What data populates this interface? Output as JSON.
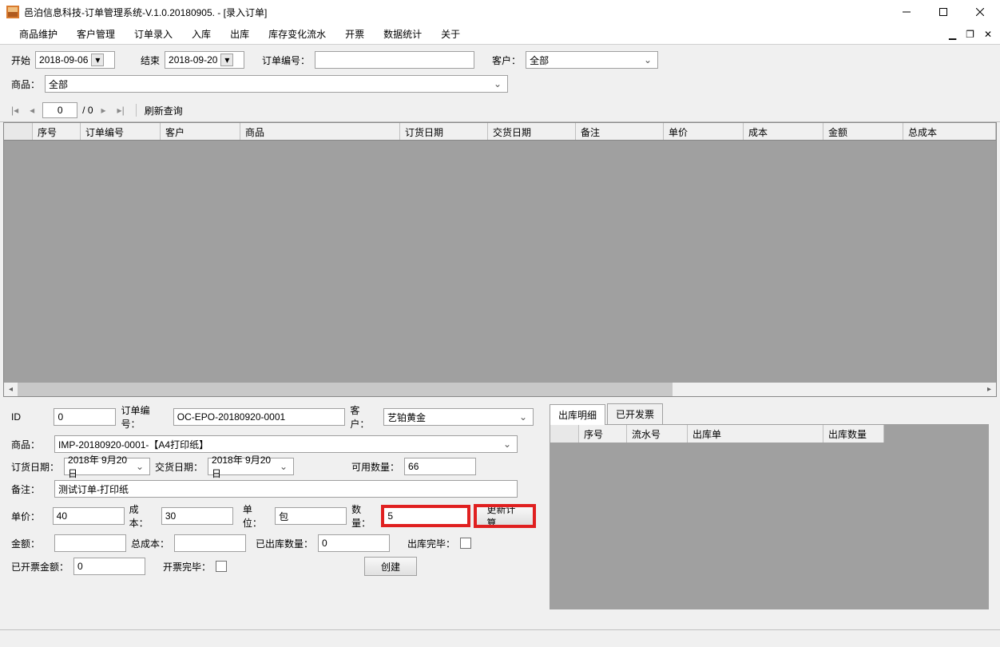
{
  "window": {
    "title": "邑泊信息科技-订单管理系统-V.1.0.20180905. - [录入订单]"
  },
  "menu": {
    "items": [
      "商品维护",
      "客户管理",
      "订单录入",
      "入库",
      "出库",
      "库存变化流水",
      "开票",
      "数据统计",
      "关于"
    ]
  },
  "filter": {
    "start_label": "开始",
    "start_date": "2018-09-06",
    "end_label": "结束",
    "end_date": "2018-09-20",
    "order_no_label": "订单编号：",
    "order_no_value": "",
    "customer_label": "客户：",
    "customer_value": "全部",
    "product_label": "商品：",
    "product_value": "全部"
  },
  "pager": {
    "current": "0",
    "total": "/ 0",
    "refresh": "刷新查询"
  },
  "grid": {
    "cols": [
      "序号",
      "订单编号",
      "客户",
      "商品",
      "订货日期",
      "交货日期",
      "备注",
      "单价",
      "成本",
      "金额",
      "总成本"
    ]
  },
  "form": {
    "id_label": "ID",
    "id_value": "0",
    "order_no_label": "订单编号：",
    "order_no_value": "OC-EPO-20180920-0001",
    "customer_label": "客户：",
    "customer_value": "艺铂黄金",
    "product_label": "商品：",
    "product_value": "IMP-20180920-0001-【A4打印纸】",
    "order_date_label": "订货日期：",
    "order_date_value": "2018年 9月20日",
    "delivery_date_label": "交货日期：",
    "delivery_date_value": "2018年 9月20日",
    "available_qty_label": "可用数量：",
    "available_qty_value": "66",
    "remark_label": "备注：",
    "remark_value": "测试订单-打印纸",
    "unit_price_label": "单价：",
    "unit_price_value": "40",
    "cost_label": "成本：",
    "cost_value": "30",
    "unit_label": "单位：",
    "unit_value": "包",
    "qty_label": "数量：",
    "qty_value": "5",
    "recalc_btn": "更新计算",
    "amount_label": "金额：",
    "amount_value": "",
    "total_cost_label": "总成本：",
    "total_cost_value": "",
    "shipped_qty_label": "已出库数量：",
    "shipped_qty_value": "0",
    "shipped_done_label": "出库完毕：",
    "invoiced_amount_label": "已开票金额：",
    "invoiced_amount_value": "0",
    "invoice_done_label": "开票完毕：",
    "create_btn": "创建"
  },
  "tabs": {
    "t1": "出库明细",
    "t2": "已开发票",
    "cols": [
      "序号",
      "流水号",
      "出库单",
      "出库数量"
    ]
  }
}
